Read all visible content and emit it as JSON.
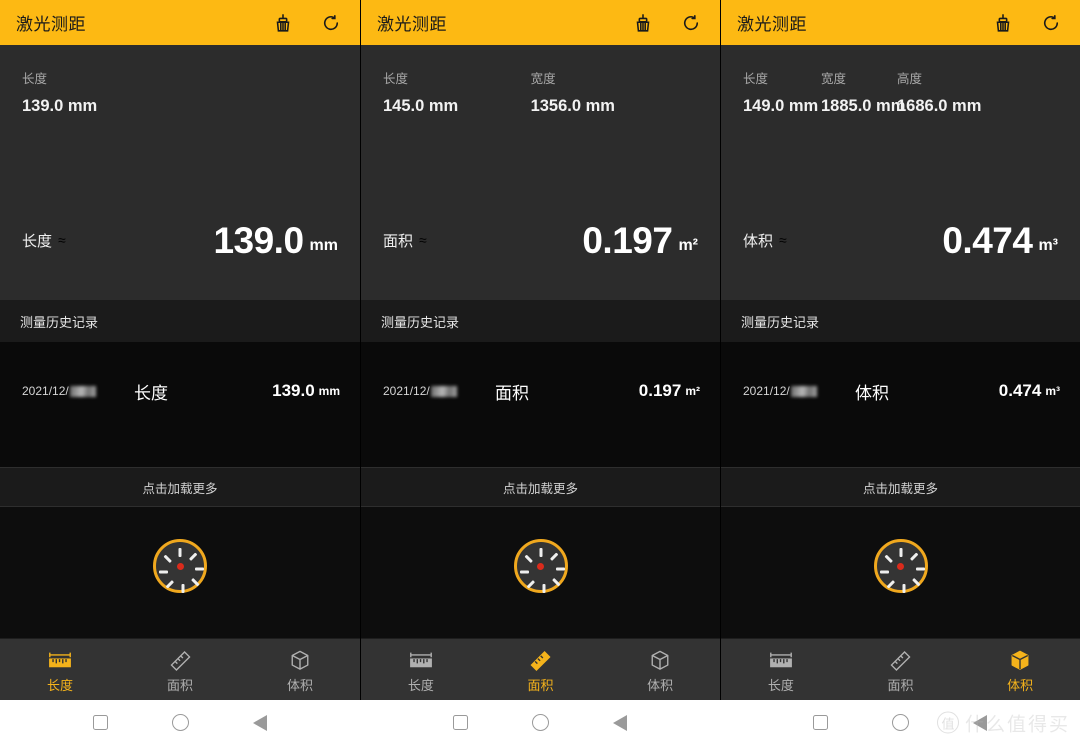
{
  "app": {
    "title": "激光测距",
    "accent_yellow": "#fdb913",
    "accent_tab_active": "#f5b31b",
    "panel_bg": "#2c2c2c",
    "history_bg": "#0a0a0a",
    "appbar_icons": [
      "broom-clean-icon",
      "refresh-icon"
    ]
  },
  "panels": [
    {
      "id": "length",
      "title": "激光测距",
      "fields": [
        {
          "label": "长度",
          "value": "139.0 mm"
        }
      ],
      "result": {
        "label": "长度",
        "approx": "≈",
        "value": "139.0",
        "unit": "mm"
      },
      "history_header": "测量历史记录",
      "history": [
        {
          "time": "",
          "date": "2021/12/",
          "type": "长度",
          "value": "139.0",
          "unit": "mm"
        }
      ],
      "load_more": "点击加载更多",
      "tabs": [
        {
          "label": "长度",
          "icon": "ruler-length-icon",
          "active": true
        },
        {
          "label": "面积",
          "icon": "ruler-area-icon",
          "active": false
        },
        {
          "label": "体积",
          "icon": "cube-volume-icon",
          "active": false
        }
      ]
    },
    {
      "id": "area",
      "title": "激光测距",
      "fields": [
        {
          "label": "长度",
          "value": "145.0 mm"
        },
        {
          "label": "宽度",
          "value": "1356.0 mm"
        }
      ],
      "result": {
        "label": "面积",
        "approx": "≈",
        "value": "0.197",
        "unit": "m²"
      },
      "history_header": "测量历史记录",
      "history": [
        {
          "time": "",
          "date": "2021/12/",
          "type": "面积",
          "value": "0.197",
          "unit": "m²"
        }
      ],
      "load_more": "点击加载更多",
      "tabs": [
        {
          "label": "长度",
          "icon": "ruler-length-icon",
          "active": false
        },
        {
          "label": "面积",
          "icon": "ruler-area-icon",
          "active": true
        },
        {
          "label": "体积",
          "icon": "cube-volume-icon",
          "active": false
        }
      ]
    },
    {
      "id": "volume",
      "title": "激光测距",
      "fields": [
        {
          "label": "长度",
          "value": "149.0 mm"
        },
        {
          "label": "宽度",
          "value": "1885.0 mm"
        },
        {
          "label": "高度",
          "value": "1686.0 mm"
        }
      ],
      "result": {
        "label": "体积",
        "approx": "≈",
        "value": "0.474",
        "unit": "m³"
      },
      "history_header": "测量历史记录",
      "history": [
        {
          "time": "",
          "date": "2021/12/",
          "type": "体积",
          "value": "0.474",
          "unit": "m³"
        }
      ],
      "load_more": "点击加载更多",
      "tabs": [
        {
          "label": "长度",
          "icon": "ruler-length-icon",
          "active": false
        },
        {
          "label": "面积",
          "icon": "ruler-area-icon",
          "active": false
        },
        {
          "label": "体积",
          "icon": "cube-volume-icon",
          "active": true
        }
      ]
    }
  ],
  "navbar": {
    "buttons": [
      {
        "name": "recents-button",
        "icon": "square-icon"
      },
      {
        "name": "home-button",
        "icon": "circle-icon"
      },
      {
        "name": "back-button",
        "icon": "triangle-left-icon"
      }
    ],
    "watermark": {
      "logo": "值",
      "text": "什么值得买"
    }
  }
}
